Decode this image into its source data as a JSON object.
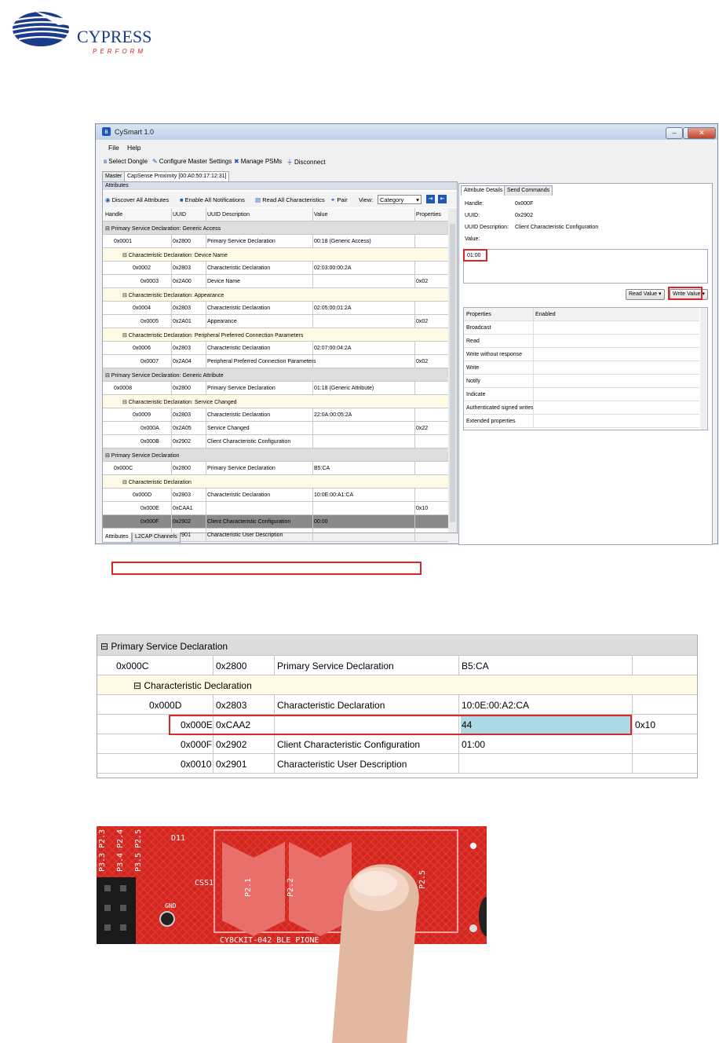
{
  "logo": {
    "brand": "CYPRESS",
    "tagline": "PERFORM"
  },
  "window": {
    "title": "CySmart 1.0",
    "menu": [
      "File",
      "Help"
    ],
    "toolbar": [
      "Select Dongle",
      "Configure Master Settings",
      "Manage PSMs",
      "Disconnect"
    ],
    "tabs": [
      "Master",
      "CapSense Proximity [00:A0:50:17:12:31]"
    ],
    "attributes_header": "Attributes",
    "attr_tools": [
      "Discover All Attributes",
      "Enable All Notifications",
      "Read All Characteristics",
      "Pair",
      "View:"
    ],
    "view_value": "Category",
    "columns": [
      "Handle",
      "UUID",
      "UUID Description",
      "Value",
      "Properties"
    ],
    "rows": [
      {
        "kind": "grp",
        "label": "Primary Service Declaration: Generic Access"
      },
      {
        "kind": "item",
        "handle": "0x0001",
        "uuid": "0x2800",
        "desc": "Primary Service Declaration",
        "value": "00:18 (Generic Access)",
        "props": ""
      },
      {
        "kind": "sub",
        "label": "Characteristic Declaration: Device Name"
      },
      {
        "kind": "item",
        "handle": "0x0002",
        "uuid": "0x2803",
        "desc": "Characteristic Declaration",
        "value": "02:03:00:00:2A",
        "props": ""
      },
      {
        "kind": "item",
        "handle": "0x0003",
        "uuid": "0x2A00",
        "desc": "Device Name",
        "value": "",
        "props": "0x02"
      },
      {
        "kind": "sub",
        "label": "Characteristic Declaration: Appearance"
      },
      {
        "kind": "item",
        "handle": "0x0004",
        "uuid": "0x2803",
        "desc": "Characteristic Declaration",
        "value": "02:05:00:01:2A",
        "props": ""
      },
      {
        "kind": "item",
        "handle": "0x0005",
        "uuid": "0x2A01",
        "desc": "Appearance",
        "value": "",
        "props": "0x02"
      },
      {
        "kind": "sub",
        "label": "Characteristic Declaration: Peripheral Preferred Connection Parameters"
      },
      {
        "kind": "item",
        "handle": "0x0006",
        "uuid": "0x2803",
        "desc": "Characteristic Declaration",
        "value": "02:07:00:04:2A",
        "props": ""
      },
      {
        "kind": "item",
        "handle": "0x0007",
        "uuid": "0x2A04",
        "desc": "Peripheral Preferred Connection Parameters",
        "value": "",
        "props": "0x02"
      },
      {
        "kind": "grp",
        "label": "Primary Service Declaration: Generic Attribute"
      },
      {
        "kind": "item",
        "handle": "0x0008",
        "uuid": "0x2800",
        "desc": "Primary Service Declaration",
        "value": "01:18 (Generic Attribute)",
        "props": ""
      },
      {
        "kind": "sub",
        "label": "Characteristic Declaration: Service Changed"
      },
      {
        "kind": "item",
        "handle": "0x0009",
        "uuid": "0x2803",
        "desc": "Characteristic Declaration",
        "value": "22:0A:00:05:2A",
        "props": ""
      },
      {
        "kind": "item",
        "handle": "0x000A",
        "uuid": "0x2A05",
        "desc": "Service Changed",
        "value": "",
        "props": "0x22"
      },
      {
        "kind": "item",
        "handle": "0x000B",
        "uuid": "0x2902",
        "desc": "Client Characteristic Configuration",
        "value": "",
        "props": ""
      },
      {
        "kind": "grp",
        "label": "Primary Service Declaration"
      },
      {
        "kind": "item",
        "handle": "0x000C",
        "uuid": "0x2800",
        "desc": "Primary Service Declaration",
        "value": "B5:CA",
        "props": ""
      },
      {
        "kind": "sub",
        "label": "Characteristic Declaration"
      },
      {
        "kind": "item",
        "handle": "0x000D",
        "uuid": "0x2803",
        "desc": "Characteristic Declaration",
        "value": "10:0E:00:A1:CA",
        "props": ""
      },
      {
        "kind": "item",
        "handle": "0x000E",
        "uuid": "0xCAA1",
        "desc": "",
        "value": "",
        "props": "0x10"
      },
      {
        "kind": "sel",
        "handle": "0x000F",
        "uuid": "0x2902",
        "desc": "Client Characteristic Configuration",
        "value": "00:00",
        "props": ""
      },
      {
        "kind": "item",
        "handle": "0x0010",
        "uuid": "0x2901",
        "desc": "Characteristic User Description",
        "value": "",
        "props": ""
      }
    ],
    "bottom_tabs": [
      "Attributes",
      "L2CAP Channels"
    ],
    "right_tabs": [
      "Attribute Details",
      "Send Commands"
    ],
    "details": {
      "handle_label": "Handle:",
      "handle": "0x000F",
      "uuid_label": "UUID:",
      "uuid": "0x2902",
      "desc_label": "UUID Description:",
      "desc": "Client Characteristic Configuration",
      "value_label": "Value:",
      "value": "01:00"
    },
    "read_value": "Read Value",
    "write_value": "Write Value",
    "props_header": [
      "Properties",
      "Enabled"
    ],
    "props": [
      "Broadcast",
      "Read",
      "Write without response",
      "Write",
      "Notify",
      "Indicate",
      "Authenticated signed writes",
      "Extended properties"
    ]
  },
  "zoom": {
    "rows": [
      {
        "kind": "grp",
        "label": "Primary Service Declaration"
      },
      {
        "kind": "item",
        "handle": "0x000C",
        "uuid": "0x2800",
        "desc": "Primary Service Declaration",
        "value": "B5:CA",
        "props": ""
      },
      {
        "kind": "sub",
        "label": "Characteristic Declaration"
      },
      {
        "kind": "item",
        "handle": "0x000D",
        "uuid": "0x2803",
        "desc": "Characteristic Declaration",
        "value": "10:0E:00:A2:CA",
        "props": ""
      },
      {
        "kind": "item",
        "handle": "0x000E",
        "uuid": "0xCAA2",
        "desc": "",
        "value": "44",
        "props": "0x10"
      },
      {
        "kind": "item",
        "handle": "0x000F",
        "uuid": "0x2902",
        "desc": "Client Characteristic Configuration",
        "value": "01:00",
        "props": ""
      },
      {
        "kind": "item",
        "handle": "0x0010",
        "uuid": "0x2901",
        "desc": "Characteristic User Description",
        "value": "",
        "props": ""
      }
    ]
  },
  "photo": {
    "header_labels": [
      "P3.3",
      "P2.3",
      "P3.4",
      "P2.4",
      "P3.5",
      "P2.5"
    ],
    "silk_d11": "D11",
    "silk_css1": "CSS1",
    "silk_gnd": "GND",
    "pads": [
      "P2.1",
      "P2.2",
      "P2.5"
    ],
    "board": "CY8CKIT-042 BLE PIONE"
  }
}
